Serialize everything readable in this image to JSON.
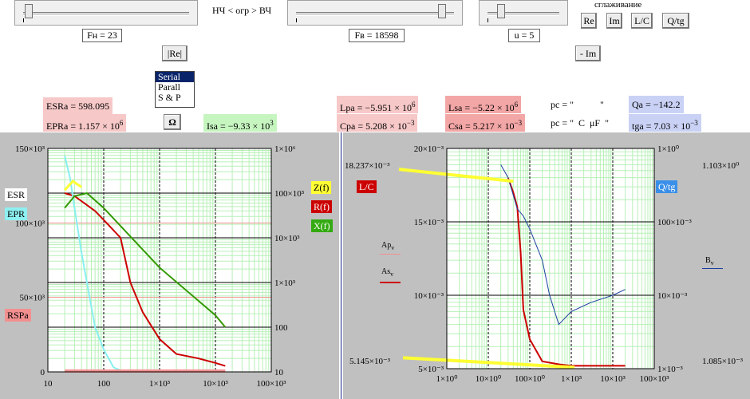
{
  "sliders": {
    "fn": {
      "label": "Fн = 23",
      "position": 0.05
    },
    "fv": {
      "label": "Fв = 18598",
      "position": 0.9
    },
    "u": {
      "label": "u = 5",
      "position": 0.2
    }
  },
  "range_label": "НЧ < огр > ВЧ",
  "smoothing_label": "сглаживание",
  "buttons": {
    "re_abs": "|Re|",
    "re": "Re",
    "im": "Im",
    "lc": "L/C",
    "qtg": "Q/tg",
    "neg_im": "- Im",
    "omega": "Ω"
  },
  "circuit_options": {
    "items": [
      "Serial",
      "Parall",
      "S & P"
    ],
    "selected": "Serial"
  },
  "values": {
    "esra": "ESRa = 598.095",
    "epra_main": "EPRa = 1.157 × 10",
    "epra_exp": "6",
    "isa_main": "Isa = −9.33 × 10",
    "isa_exp": "3",
    "lpa_main": "Lpa = −5.951 × 10",
    "lpa_exp": "6",
    "cpa_main": "Cpa = 5.208 × 10",
    "cpa_exp": "−3",
    "lsa_main": "Lsa = −5.22 × 10",
    "lsa_exp": "6",
    "csa_main": "Csa = 5.217 × 10",
    "csa_exp": "−3",
    "pc1": "pc = \"           \"",
    "pc2": "pc = \"  C  μF  \"",
    "qa": "Qa = −142.2",
    "tga_main": "tga = 7.03 × 10",
    "tga_exp": "−3"
  },
  "chart_data": [
    {
      "type": "line",
      "title": "",
      "xscale": "log",
      "x_ticks": [
        "10",
        "100",
        "1×10³",
        "10×10³",
        "100×10³"
      ],
      "y_left_ticks": [
        "150×10³",
        "100×10³",
        "50×10³",
        "0"
      ],
      "y_left_range": [
        0,
        150000
      ],
      "y_right_ticks": [
        "1×10⁶",
        "100×10³",
        "10×10³",
        "1×10³",
        "100",
        "10"
      ],
      "y_right_range": [
        10,
        1000000
      ],
      "y_right_scale": "log",
      "legend_left": [
        "ESR",
        "EPR",
        "RSPa"
      ],
      "legend_right": [
        "Z(f)",
        "R(f)",
        "X(f)"
      ],
      "colors": {
        "esr": "#cc0000",
        "epr": "#88f0f0",
        "z": "#ffff33",
        "r": "#cc0000",
        "x": "#339900",
        "rspa": "#f29090"
      },
      "series": [
        {
          "name": "ESR",
          "x": [
            20,
            30,
            50,
            70,
            100,
            150,
            200,
            300,
            500,
            1000,
            2000,
            5000,
            10000,
            15000
          ],
          "y": [
            120000,
            118000,
            112000,
            108000,
            102000,
            95000,
            90000,
            60000,
            40000,
            22000,
            12000,
            9000,
            6000,
            4000
          ]
        },
        {
          "name": "EPR",
          "x": [
            20,
            25,
            30,
            40,
            50,
            70,
            100,
            150,
            200
          ],
          "y": [
            145000,
            130000,
            110000,
            80000,
            60000,
            30000,
            15000,
            3000,
            1000
          ]
        },
        {
          "name": "X(f)",
          "x": [
            20,
            30,
            50,
            100,
            1000,
            10000,
            15000
          ],
          "y": [
            110000,
            118000,
            120000,
            110000,
            70000,
            38000,
            30000
          ]
        }
      ]
    },
    {
      "type": "line",
      "title": "",
      "xscale": "log",
      "x_ticks": [
        "1×10⁰",
        "10×10⁰",
        "100×10⁰",
        "1×10³",
        "10×10³",
        "100×10³"
      ],
      "y_left_ticks": [
        "20×10⁻³",
        "15×10⁻³",
        "10×10⁻³",
        "5×10⁻³"
      ],
      "y_left_range": [
        5,
        20
      ],
      "y_right_ticks": [
        "1×10⁰",
        "100×10⁻³",
        "10×10⁻³",
        "1×10⁻³"
      ],
      "y_right_range": [
        0.001,
        1
      ],
      "y_right_scale": "log",
      "annotations": [
        "18.237×10⁻³",
        "5.145×10⁻³",
        "1.103×10⁰",
        "1.085×10⁻³"
      ],
      "legend_left": [
        "L/C"
      ],
      "legend_right": [
        "Q/tg"
      ],
      "legend_inner": [
        "Apv",
        "Asv",
        "Bv"
      ],
      "colors": {
        "lc": "#cc0000",
        "qtg": "#1a3fa0",
        "markers": "#ffff33"
      },
      "series": [
        {
          "name": "As",
          "x": [
            30,
            40,
            50,
            60,
            70,
            100,
            200,
            500,
            1000,
            10000,
            20000
          ],
          "y": [
            18,
            17,
            16,
            13,
            9,
            7,
            5.5,
            5.3,
            5.2,
            5.2,
            5.2
          ]
        },
        {
          "name": "B",
          "x": [
            20,
            30,
            50,
            70,
            100,
            200,
            300,
            500,
            1000,
            3000,
            10000,
            20000
          ],
          "y": [
            0.6,
            0.4,
            0.15,
            0.12,
            0.08,
            0.03,
            0.01,
            0.004,
            0.006,
            0.008,
            0.01,
            0.012
          ]
        }
      ]
    }
  ]
}
